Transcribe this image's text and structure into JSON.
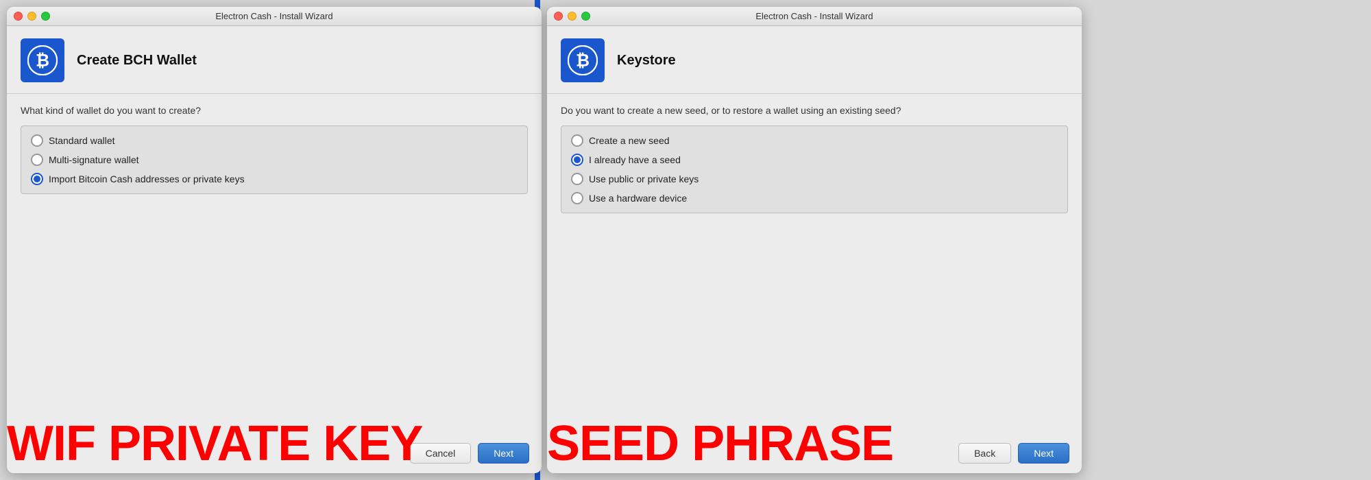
{
  "left": {
    "titleBar": {
      "text": "Electron Cash  -  Install Wizard"
    },
    "header": {
      "title": "Create BCH Wallet"
    },
    "body": {
      "question": "What kind of wallet do you want to create?",
      "options": [
        {
          "id": "standard",
          "label": "Standard wallet",
          "selected": false
        },
        {
          "id": "multisig",
          "label": "Multi-signature wallet",
          "selected": false
        },
        {
          "id": "import",
          "label": "Import Bitcoin Cash addresses or private keys",
          "selected": true
        }
      ]
    },
    "footer": {
      "cancelLabel": "Cancel",
      "nextLabel": "Next"
    },
    "bigLabel": "WIF PRIVATE KEY"
  },
  "right": {
    "titleBar": {
      "text": "Electron Cash  -  Install Wizard"
    },
    "header": {
      "title": "Keystore"
    },
    "body": {
      "question": "Do you want to create a new seed, or to restore a wallet using an existing seed?",
      "options": [
        {
          "id": "new-seed",
          "label": "Create a new seed",
          "selected": false
        },
        {
          "id": "have-seed",
          "label": "I already have a seed",
          "selected": true
        },
        {
          "id": "pub-priv",
          "label": "Use public or private keys",
          "selected": false
        },
        {
          "id": "hardware",
          "label": "Use a hardware device",
          "selected": false
        }
      ]
    },
    "footer": {
      "backLabel": "Back",
      "nextLabel": "Next"
    },
    "bigLabel": "SEED PHRASE"
  }
}
